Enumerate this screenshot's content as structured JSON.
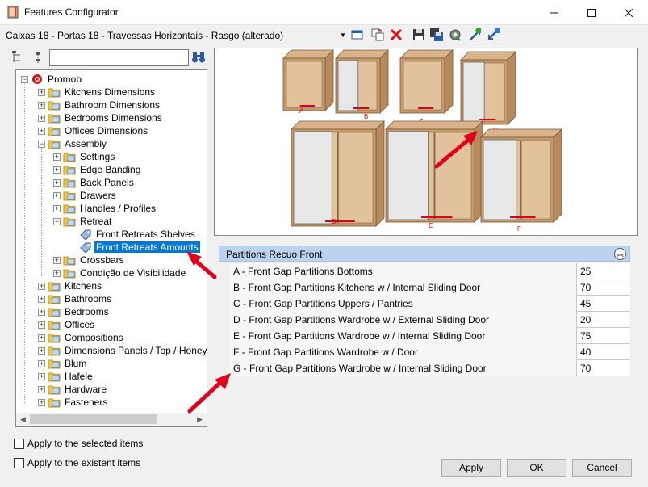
{
  "window": {
    "title": "Features Configurator"
  },
  "toolbar": {
    "config_name": "Caixas 18 - Portas 18 - Travessas Horizontais - Rasgo (alterado)",
    "icons": [
      "dropdown-icon",
      "window-icon",
      "copy-icon",
      "delete-icon",
      "save-icon",
      "save-as-icon",
      "settings-icon",
      "import-icon",
      "export-icon"
    ]
  },
  "search": {
    "value": "",
    "placeholder": ""
  },
  "tree": {
    "items": [
      {
        "label": "Promob",
        "level": 0,
        "expander": "−"
      },
      {
        "label": "Kitchens Dimensions",
        "level": 1,
        "expander": "+"
      },
      {
        "label": "Bathroom Dimensions",
        "level": 1,
        "expander": "+"
      },
      {
        "label": "Bedrooms Dimensions",
        "level": 1,
        "expander": "+"
      },
      {
        "label": "Offices Dimensions",
        "level": 1,
        "expander": "+"
      },
      {
        "label": "Assembly",
        "level": 1,
        "expander": "−"
      },
      {
        "label": "Settings",
        "level": 2,
        "expander": "+"
      },
      {
        "label": "Edge Banding",
        "level": 2,
        "expander": "+"
      },
      {
        "label": "Back Panels",
        "level": 2,
        "expander": "+"
      },
      {
        "label": "Drawers",
        "level": 2,
        "expander": "+"
      },
      {
        "label": "Handles / Profiles",
        "level": 2,
        "expander": "+"
      },
      {
        "label": "Retreat",
        "level": 2,
        "expander": "−"
      },
      {
        "label": "Front Retreats Shelves",
        "level": 3,
        "expander": ""
      },
      {
        "label": "Front Retreats Amounts",
        "level": 3,
        "expander": "",
        "selected": true
      },
      {
        "label": "Crossbars",
        "level": 2,
        "expander": "+"
      },
      {
        "label": "Condição de Visibilidade",
        "level": 2,
        "expander": "+"
      },
      {
        "label": "Kitchens",
        "level": 1,
        "expander": "+"
      },
      {
        "label": "Bathrooms",
        "level": 1,
        "expander": "+"
      },
      {
        "label": "Bedrooms",
        "level": 1,
        "expander": "+"
      },
      {
        "label": "Offices",
        "level": 1,
        "expander": "+"
      },
      {
        "label": "Compositions",
        "level": 1,
        "expander": "+"
      },
      {
        "label": "Dimensions Panels / Top / Honeycor",
        "level": 1,
        "expander": "+"
      },
      {
        "label": "Blum",
        "level": 1,
        "expander": "+"
      },
      {
        "label": "Hafele",
        "level": 1,
        "expander": "+"
      },
      {
        "label": "Hardware",
        "level": 1,
        "expander": "+"
      },
      {
        "label": "Fasteners",
        "level": 1,
        "expander": "+"
      }
    ]
  },
  "preview": {
    "labels": [
      "A",
      "B",
      "C",
      "G",
      "D",
      "E",
      "F"
    ]
  },
  "grid": {
    "title": "Partitions Recuo Front",
    "rows": [
      {
        "name": "A - Front Gap Partitions Bottoms",
        "value": "25"
      },
      {
        "name": "B - Front Gap Partitions Kitchens w / Internal Sliding Door",
        "value": "70"
      },
      {
        "name": "C - Front Gap Partitions Uppers / Pantries",
        "value": "45"
      },
      {
        "name": "D - Front Gap Partitions Wardrobe w / External Sliding Door",
        "value": "20"
      },
      {
        "name": "E - Front Gap Partitions Wardrobe w / Internal Sliding Door",
        "value": "75"
      },
      {
        "name": "F - Front Gap Partitions Wardrobe w / Door",
        "value": "40"
      },
      {
        "name": "G - Front Gap Partitions Wardrobe w / Internal Sliding Door",
        "value": "70"
      }
    ]
  },
  "options": {
    "apply_selected": "Apply to the selected items",
    "apply_existent": "Apply to the existent items"
  },
  "buttons": {
    "apply": "Apply",
    "ok": "OK",
    "cancel": "Cancel"
  },
  "colors": {
    "selection": "#0078d7",
    "grid_header": "#bcd3ee",
    "annotation_arrow": "#e0001b",
    "wood": "#c49a6c"
  }
}
